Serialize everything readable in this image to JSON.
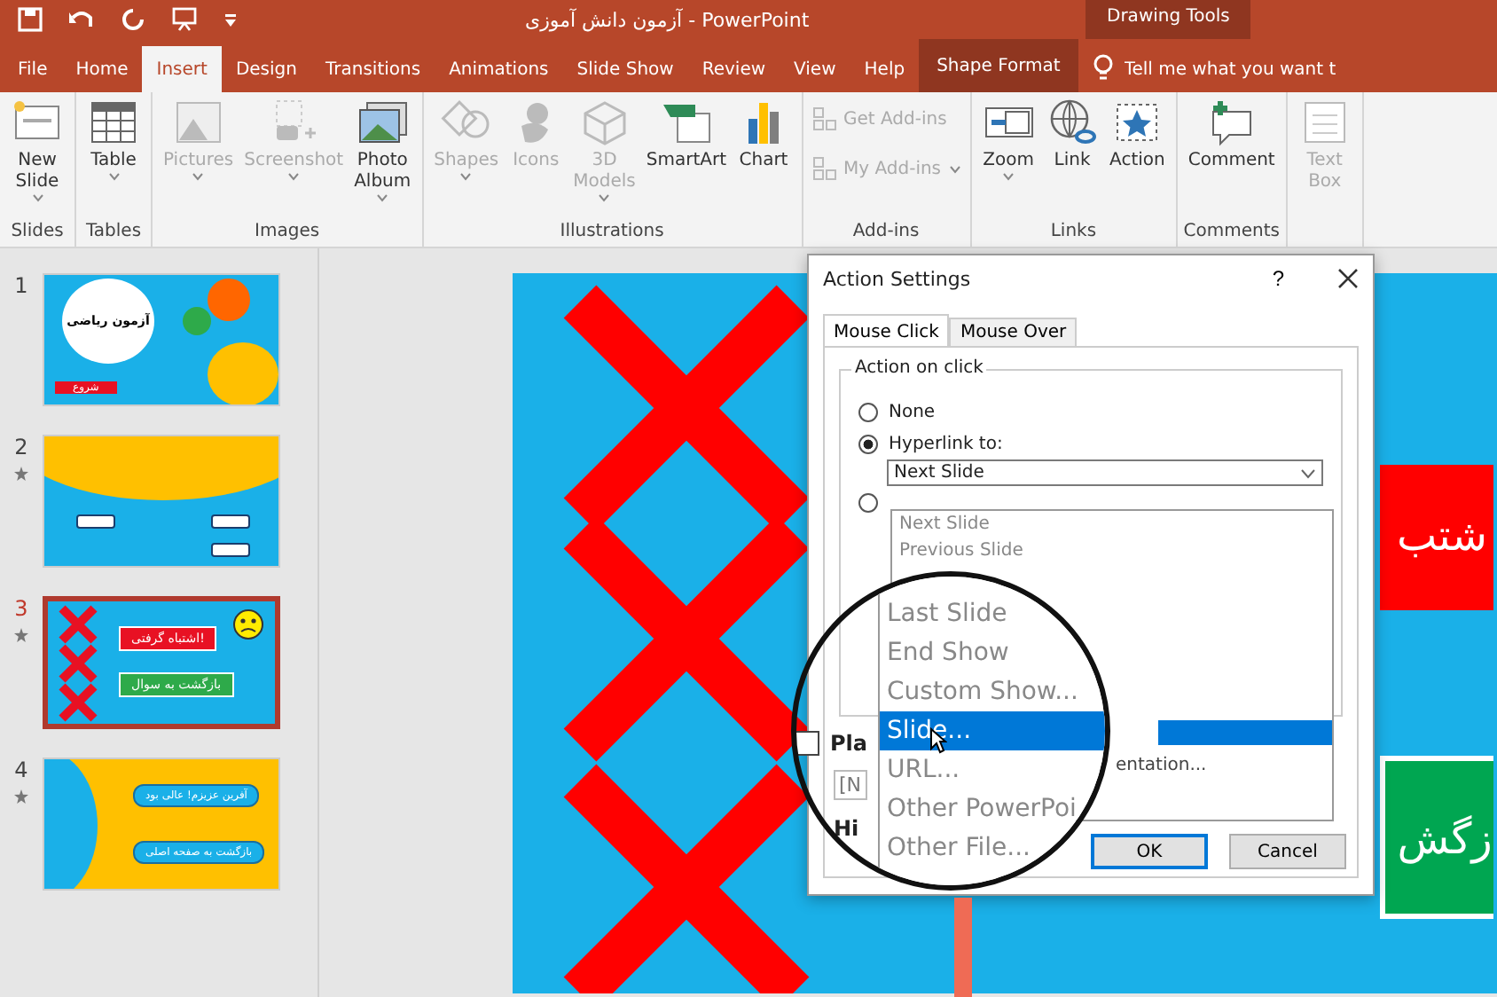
{
  "title_bar": {
    "title": "آزمون دانش آموزی - PowerPoint",
    "context_label": "Drawing Tools"
  },
  "tabs": [
    {
      "label": "File",
      "selected": false,
      "kind": "normal"
    },
    {
      "label": "Home",
      "selected": false,
      "kind": "normal"
    },
    {
      "label": "Insert",
      "selected": true,
      "kind": "normal"
    },
    {
      "label": "Design",
      "selected": false,
      "kind": "normal"
    },
    {
      "label": "Transitions",
      "selected": false,
      "kind": "normal"
    },
    {
      "label": "Animations",
      "selected": false,
      "kind": "normal"
    },
    {
      "label": "Slide Show",
      "selected": false,
      "kind": "normal"
    },
    {
      "label": "Review",
      "selected": false,
      "kind": "normal"
    },
    {
      "label": "View",
      "selected": false,
      "kind": "normal"
    },
    {
      "label": "Help",
      "selected": false,
      "kind": "normal"
    },
    {
      "label": "Shape Format",
      "selected": false,
      "kind": "context"
    }
  ],
  "tell_me": {
    "placeholder": "Tell me what you want t"
  },
  "ribbon_groups": [
    {
      "label": "Slides",
      "commands": [
        {
          "label": "New Slide",
          "disabled": false,
          "dropdown": true,
          "kind": "large"
        }
      ]
    },
    {
      "label": "Tables",
      "commands": [
        {
          "label": "Table",
          "disabled": false,
          "dropdown": true,
          "kind": "large"
        }
      ]
    },
    {
      "label": "Images",
      "commands": [
        {
          "label": "Pictures",
          "disabled": true,
          "dropdown": true,
          "kind": "large"
        },
        {
          "label": "Screenshot",
          "disabled": true,
          "dropdown": true,
          "kind": "large"
        },
        {
          "label": "Photo Album",
          "disabled": false,
          "dropdown": true,
          "kind": "large"
        }
      ]
    },
    {
      "label": "Illustrations",
      "commands": [
        {
          "label": "Shapes",
          "disabled": true,
          "dropdown": true,
          "kind": "large"
        },
        {
          "label": "Icons",
          "disabled": true,
          "dropdown": false,
          "kind": "large"
        },
        {
          "label": "3D Models",
          "disabled": true,
          "dropdown": true,
          "kind": "large"
        },
        {
          "label": "SmartArt",
          "disabled": false,
          "dropdown": false,
          "kind": "large"
        },
        {
          "label": "Chart",
          "disabled": false,
          "dropdown": false,
          "kind": "large"
        }
      ]
    },
    {
      "label": "Add-ins",
      "commands": [
        {
          "label": "Get Add-ins",
          "disabled": true,
          "dropdown": false,
          "kind": "small"
        },
        {
          "label": "My Add-ins",
          "disabled": true,
          "dropdown": true,
          "kind": "small"
        }
      ]
    },
    {
      "label": "Links",
      "commands": [
        {
          "label": "Zoom",
          "disabled": false,
          "dropdown": true,
          "kind": "large"
        },
        {
          "label": "Link",
          "disabled": false,
          "dropdown": false,
          "kind": "large"
        },
        {
          "label": "Action",
          "disabled": false,
          "dropdown": false,
          "kind": "large"
        }
      ]
    },
    {
      "label": "Comments",
      "commands": [
        {
          "label": "Comment",
          "disabled": false,
          "dropdown": false,
          "kind": "large"
        }
      ]
    },
    {
      "commands": [
        {
          "label": "Text Box",
          "disabled": true,
          "dropdown": false,
          "kind": "large"
        }
      ]
    }
  ],
  "thumbnails": [
    {
      "number": "1",
      "selected": false,
      "starred": false,
      "kind": "title",
      "texts": [
        "آزمون ریاضی",
        "شروع"
      ]
    },
    {
      "number": "2",
      "selected": false,
      "starred": true,
      "kind": "question"
    },
    {
      "number": "3",
      "selected": true,
      "starred": true,
      "kind": "wrong",
      "texts": [
        "اشتباه گرفتی!",
        "بازگشت به سوال"
      ]
    },
    {
      "number": "4",
      "selected": false,
      "starred": true,
      "kind": "right",
      "texts": [
        "آفرین عزیزم! عالی بود",
        "بازگشت به صفحه اصلی"
      ]
    }
  ],
  "slide": {
    "buttons": [
      {
        "text": "شتب",
        "color": "#ff0000",
        "selected": false
      },
      {
        "text": "زگش",
        "color": "#00a651",
        "selected": true
      }
    ]
  },
  "dialog": {
    "title": "Action Settings",
    "help": "?",
    "tabs": [
      {
        "label": "Mouse Click",
        "selected": true
      },
      {
        "label": "Mouse Over",
        "selected": false
      }
    ],
    "legend": "Action on click",
    "radios": [
      {
        "label": "None",
        "checked": false
      },
      {
        "label": "Hyperlink to:",
        "checked": true
      },
      {
        "checked": false
      }
    ],
    "combo_value": "Next Slide",
    "list_items": [
      {
        "label": "Next Slide"
      },
      {
        "label": "Previous Slide"
      }
    ],
    "lens_items": [
      {
        "label": "Last Slide",
        "selected": false
      },
      {
        "label": "End Show",
        "selected": false
      },
      {
        "label": "Custom Show...",
        "selected": false
      },
      {
        "label": "Slide...",
        "selected": true
      },
      {
        "label": "URL...",
        "selected": false
      },
      {
        "label": "Other PowerPoi",
        "selected": false
      },
      {
        "label": "Other File...",
        "selected": false
      }
    ],
    "behind": {
      "checkbox_label": "Pla",
      "checked": false,
      "field_value": "[N",
      "option_label": "Hi",
      "list_text": "entation..."
    },
    "buttons": [
      "OK",
      "Cancel"
    ]
  }
}
